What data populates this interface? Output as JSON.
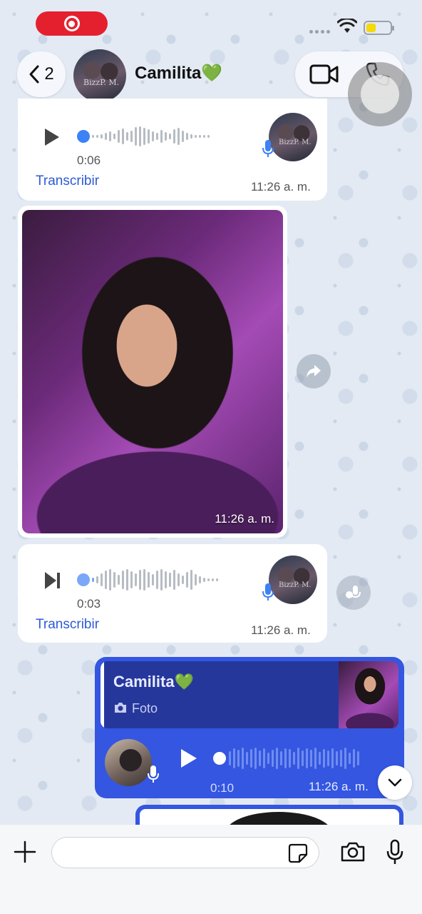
{
  "status_bar": {
    "recording_icon": "screen-record-icon",
    "wifi_icon": "wifi-icon",
    "battery_icon": "battery-icon",
    "battery_color": "#f5d90a"
  },
  "header": {
    "back_count": "2",
    "contact_name": "Camilita💚",
    "avatar_watermark": "BizzP. M."
  },
  "messages": {
    "voice1": {
      "duration": "0:06",
      "transcribe": "Transcribir",
      "time": "11:26 a. m."
    },
    "photo": {
      "time": "11:26 a. m."
    },
    "voice2": {
      "duration": "0:03",
      "transcribe": "Transcribir",
      "time": "11:26 a. m."
    },
    "outgoing": {
      "quote_name": "Camilita💚",
      "quote_sub": "Foto",
      "duration": "0:10",
      "time": "11:26 a. m."
    }
  },
  "composer": {
    "input_value": "",
    "input_placeholder": ""
  },
  "colors": {
    "outgoing_bubble": "#3456e0",
    "quote_bg": "#26379c",
    "link": "#2d5bd6",
    "rec_pill": "#e5202e"
  }
}
